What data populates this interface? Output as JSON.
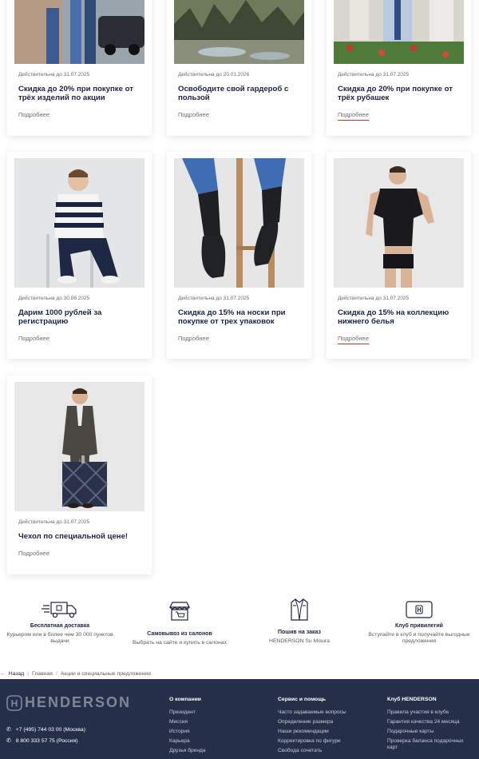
{
  "promos": [
    {
      "valid": "Действительна до 31.07.2025",
      "title": "Скидка до 20% при покупке от трёх изделий по акции",
      "more": "Подробнее"
    },
    {
      "valid": "Действительна до 20.01.2026",
      "title": "Освободите свой гардероб с пользой",
      "more": "Подробнее"
    },
    {
      "valid": "Действительна до 31.07.2025",
      "title": "Скидка до 20% при покупке от трёх рубашек",
      "more": "Подробнее"
    },
    {
      "valid": "Действительна до 30.06.2025",
      "title": "Дарим 1000 рублей за регистрацию",
      "more": "Подробнее"
    },
    {
      "valid": "Действительна до 31.07.2025",
      "title": "Скидка до 15% на носки при покупке от трех упаковок",
      "more": "Подробнее"
    },
    {
      "valid": "Действительна до 31.07.2025",
      "title": "Скидка до 15% на коллекцию нижнего белья",
      "more": "Подробнее"
    },
    {
      "valid": "Действительна до 31.07.2025",
      "title": "Чехол по специальной цене!",
      "more": "Подробнее"
    }
  ],
  "benefits": [
    {
      "icon": "delivery-truck-icon",
      "title": "Бесплатная доставка",
      "desc": "Курьером или в более чем 30 000 пунктов выдачи"
    },
    {
      "icon": "store-cart-icon",
      "title": "Самовывоз из салонов",
      "desc": "Выбрать на сайте и купить в салонах"
    },
    {
      "icon": "suit-jacket-icon",
      "title": "Пошив на заказ",
      "desc": "HENDERSON Su Misura"
    },
    {
      "icon": "club-card-icon",
      "title": "Клуб привилегий",
      "desc": "Вступайте в клуб и получайте выгодные предложения"
    }
  ],
  "breadcrumbs": {
    "back": "Назад",
    "home": "Главная",
    "current": "Акции и специальные предложения",
    "sep": "/"
  },
  "footer": {
    "brand": "HENDERSON",
    "brand_mark": "H",
    "phones": [
      "+7 (495) 744 03 00 (Москва)",
      "8 800 333 57 75 (Россия)"
    ],
    "columns": [
      {
        "title": "О компании",
        "links": [
          "Президент",
          "Миссия",
          "История",
          "Карьера",
          "Друзья бренда"
        ]
      },
      {
        "title": "Сервис и помощь",
        "links": [
          "Часто задаваемые вопросы",
          "Определение размера",
          "Наши рекомендации",
          "Корректировка по фигуре",
          "Свобода сочетать"
        ]
      },
      {
        "title": "Клуб HENDERSON",
        "links": [
          "Правила участия в клубе",
          "Гарантия качества 24 месяца",
          "Подарочные карты",
          "Проверка баланса подарочных карт"
        ]
      }
    ]
  },
  "colors": {
    "navy": "#252f49",
    "accent_underline": "#c0392b",
    "text": "#1a2340"
  }
}
